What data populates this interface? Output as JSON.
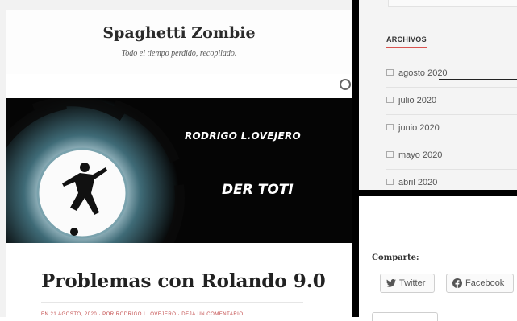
{
  "site": {
    "title": "Spaghetti Zombie",
    "description": "Todo el tiempo perdido, recopilado."
  },
  "hero": {
    "author_text": "RODRIGO L.OVEJERO",
    "subtitle": "DER TOTI"
  },
  "post": {
    "title": "Problemas con Rolando 9.0",
    "meta": "EN 21 AGOSTO, 2020  ·  POR RODRIGO L. OVEJERO  ·  DEJA UN COMENTARIO"
  },
  "archives": {
    "title": "ARCHIVOS",
    "items": [
      "agosto 2020",
      "julio 2020",
      "junio 2020",
      "mayo 2020",
      "abril 2020"
    ]
  },
  "share": {
    "title": "Comparte:",
    "twitter_label": "Twitter",
    "facebook_label": "Facebook"
  },
  "colors": {
    "accent": "#d9534f",
    "meta_red": "#c24a4a",
    "hero_bg": "#050505"
  }
}
